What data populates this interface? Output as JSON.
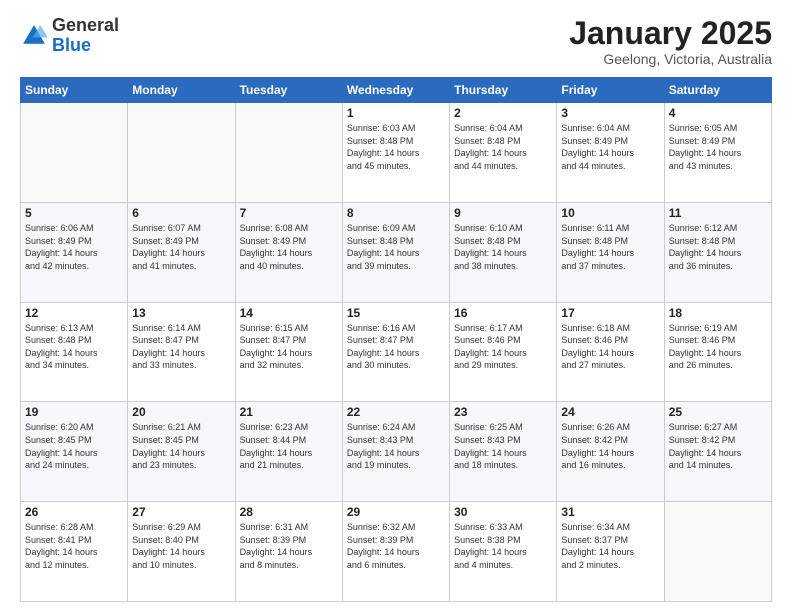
{
  "header": {
    "logo_general": "General",
    "logo_blue": "Blue",
    "month_title": "January 2025",
    "subtitle": "Geelong, Victoria, Australia"
  },
  "days_of_week": [
    "Sunday",
    "Monday",
    "Tuesday",
    "Wednesday",
    "Thursday",
    "Friday",
    "Saturday"
  ],
  "weeks": [
    [
      {
        "day": "",
        "info": ""
      },
      {
        "day": "",
        "info": ""
      },
      {
        "day": "",
        "info": ""
      },
      {
        "day": "1",
        "info": "Sunrise: 6:03 AM\nSunset: 8:48 PM\nDaylight: 14 hours\nand 45 minutes."
      },
      {
        "day": "2",
        "info": "Sunrise: 6:04 AM\nSunset: 8:48 PM\nDaylight: 14 hours\nand 44 minutes."
      },
      {
        "day": "3",
        "info": "Sunrise: 6:04 AM\nSunset: 8:49 PM\nDaylight: 14 hours\nand 44 minutes."
      },
      {
        "day": "4",
        "info": "Sunrise: 6:05 AM\nSunset: 8:49 PM\nDaylight: 14 hours\nand 43 minutes."
      }
    ],
    [
      {
        "day": "5",
        "info": "Sunrise: 6:06 AM\nSunset: 8:49 PM\nDaylight: 14 hours\nand 42 minutes."
      },
      {
        "day": "6",
        "info": "Sunrise: 6:07 AM\nSunset: 8:49 PM\nDaylight: 14 hours\nand 41 minutes."
      },
      {
        "day": "7",
        "info": "Sunrise: 6:08 AM\nSunset: 8:49 PM\nDaylight: 14 hours\nand 40 minutes."
      },
      {
        "day": "8",
        "info": "Sunrise: 6:09 AM\nSunset: 8:48 PM\nDaylight: 14 hours\nand 39 minutes."
      },
      {
        "day": "9",
        "info": "Sunrise: 6:10 AM\nSunset: 8:48 PM\nDaylight: 14 hours\nand 38 minutes."
      },
      {
        "day": "10",
        "info": "Sunrise: 6:11 AM\nSunset: 8:48 PM\nDaylight: 14 hours\nand 37 minutes."
      },
      {
        "day": "11",
        "info": "Sunrise: 6:12 AM\nSunset: 8:48 PM\nDaylight: 14 hours\nand 36 minutes."
      }
    ],
    [
      {
        "day": "12",
        "info": "Sunrise: 6:13 AM\nSunset: 8:48 PM\nDaylight: 14 hours\nand 34 minutes."
      },
      {
        "day": "13",
        "info": "Sunrise: 6:14 AM\nSunset: 8:47 PM\nDaylight: 14 hours\nand 33 minutes."
      },
      {
        "day": "14",
        "info": "Sunrise: 6:15 AM\nSunset: 8:47 PM\nDaylight: 14 hours\nand 32 minutes."
      },
      {
        "day": "15",
        "info": "Sunrise: 6:16 AM\nSunset: 8:47 PM\nDaylight: 14 hours\nand 30 minutes."
      },
      {
        "day": "16",
        "info": "Sunrise: 6:17 AM\nSunset: 8:46 PM\nDaylight: 14 hours\nand 29 minutes."
      },
      {
        "day": "17",
        "info": "Sunrise: 6:18 AM\nSunset: 8:46 PM\nDaylight: 14 hours\nand 27 minutes."
      },
      {
        "day": "18",
        "info": "Sunrise: 6:19 AM\nSunset: 8:46 PM\nDaylight: 14 hours\nand 26 minutes."
      }
    ],
    [
      {
        "day": "19",
        "info": "Sunrise: 6:20 AM\nSunset: 8:45 PM\nDaylight: 14 hours\nand 24 minutes."
      },
      {
        "day": "20",
        "info": "Sunrise: 6:21 AM\nSunset: 8:45 PM\nDaylight: 14 hours\nand 23 minutes."
      },
      {
        "day": "21",
        "info": "Sunrise: 6:23 AM\nSunset: 8:44 PM\nDaylight: 14 hours\nand 21 minutes."
      },
      {
        "day": "22",
        "info": "Sunrise: 6:24 AM\nSunset: 8:43 PM\nDaylight: 14 hours\nand 19 minutes."
      },
      {
        "day": "23",
        "info": "Sunrise: 6:25 AM\nSunset: 8:43 PM\nDaylight: 14 hours\nand 18 minutes."
      },
      {
        "day": "24",
        "info": "Sunrise: 6:26 AM\nSunset: 8:42 PM\nDaylight: 14 hours\nand 16 minutes."
      },
      {
        "day": "25",
        "info": "Sunrise: 6:27 AM\nSunset: 8:42 PM\nDaylight: 14 hours\nand 14 minutes."
      }
    ],
    [
      {
        "day": "26",
        "info": "Sunrise: 6:28 AM\nSunset: 8:41 PM\nDaylight: 14 hours\nand 12 minutes."
      },
      {
        "day": "27",
        "info": "Sunrise: 6:29 AM\nSunset: 8:40 PM\nDaylight: 14 hours\nand 10 minutes."
      },
      {
        "day": "28",
        "info": "Sunrise: 6:31 AM\nSunset: 8:39 PM\nDaylight: 14 hours\nand 8 minutes."
      },
      {
        "day": "29",
        "info": "Sunrise: 6:32 AM\nSunset: 8:39 PM\nDaylight: 14 hours\nand 6 minutes."
      },
      {
        "day": "30",
        "info": "Sunrise: 6:33 AM\nSunset: 8:38 PM\nDaylight: 14 hours\nand 4 minutes."
      },
      {
        "day": "31",
        "info": "Sunrise: 6:34 AM\nSunset: 8:37 PM\nDaylight: 14 hours\nand 2 minutes."
      },
      {
        "day": "",
        "info": ""
      }
    ]
  ]
}
